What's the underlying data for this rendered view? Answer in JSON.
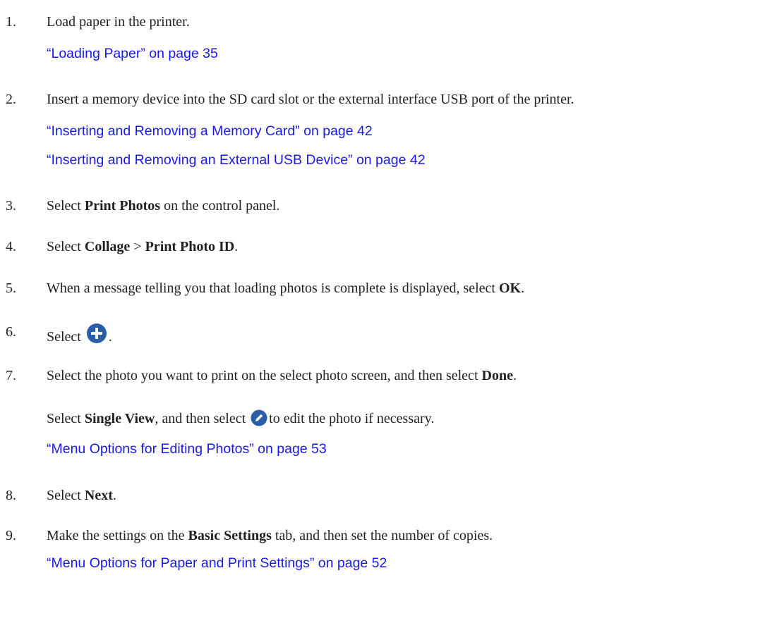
{
  "steps": [
    {
      "number": "1.",
      "text": "Load paper in the printer.",
      "links": [
        "“Loading Paper” on page 35"
      ]
    },
    {
      "number": "2.",
      "text": "Insert a memory device into the SD card slot or the external interface USB port of the printer.",
      "links": [
        "“Inserting and Removing a Memory Card” on page 42",
        "“Inserting and Removing an External USB Device” on page 42"
      ]
    },
    {
      "number": "3.",
      "parts": [
        "Select ",
        "Print Photos",
        " on the control panel."
      ]
    },
    {
      "number": "4.",
      "parts": [
        "Select ",
        "Collage",
        " > ",
        "Print Photo ID",
        "."
      ]
    },
    {
      "number": "5.",
      "parts": [
        "When a message telling you that loading photos is complete is displayed, select ",
        "OK",
        "."
      ]
    },
    {
      "number": "6.",
      "parts": [
        "Select",
        "."
      ],
      "icon": "plus-circle-icon"
    },
    {
      "number": "7.",
      "parts": [
        "Select the photo you want to print on the select photo screen, and then select ",
        "Done",
        "."
      ],
      "note_parts": [
        "Select ",
        "Single View",
        ", and then select",
        "to edit the photo if necessary."
      ],
      "note_icon": "pencil-circle-icon",
      "links": [
        "“Menu Options for Editing Photos” on page 53"
      ]
    },
    {
      "number": "8.",
      "parts": [
        "Select ",
        "Next",
        "."
      ]
    },
    {
      "number": "9.",
      "parts": [
        "Make the settings on the ",
        "Basic Settings",
        " tab, and then set the number of copies."
      ],
      "links": [
        "“Menu Options for Paper and Print Settings” on page 52"
      ]
    }
  ],
  "colors": {
    "text": "#231f20",
    "link": "#1a1ae8",
    "icon": "#2c5ea8"
  }
}
